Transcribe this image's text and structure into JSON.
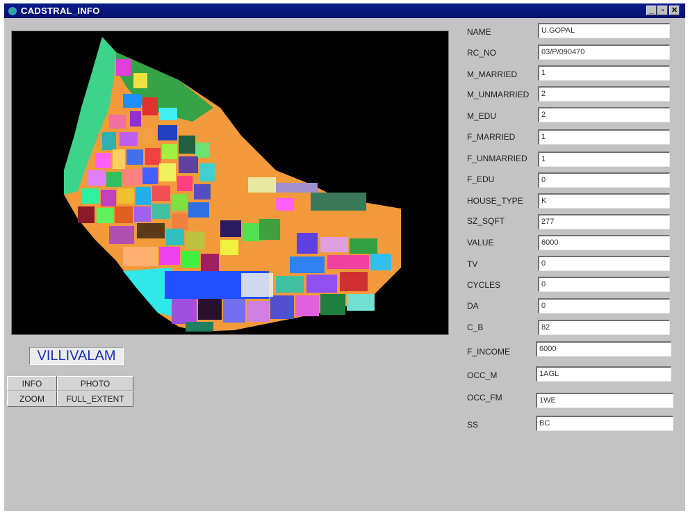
{
  "window": {
    "title": "CADSTRAL_INFO",
    "controls": {
      "minimize": "_",
      "restore": "▫",
      "close": "✕"
    }
  },
  "village_label": "VILLIVALAM",
  "toolbar": {
    "info": "INFO",
    "photo": "PHOTO",
    "zoom": "ZOOM",
    "full_extent": "FULL_EXTENT"
  },
  "fields": [
    {
      "label": "NAME",
      "value": "U.GOPAL"
    },
    {
      "label": "RC_NO",
      "value": "03/P/090470"
    },
    {
      "label": "M_MARRIED",
      "value": "1"
    },
    {
      "label": "M_UNMARRIED",
      "value": "2"
    },
    {
      "label": "M_EDU",
      "value": "2"
    },
    {
      "label": "F_MARRIED",
      "value": "1"
    },
    {
      "label": "F_UNMARRIED",
      "value": "1"
    },
    {
      "label": "F_EDU",
      "value": "0"
    },
    {
      "label": "HOUSE_TYPE",
      "value": "K"
    },
    {
      "label": "SZ_SQFT",
      "value": "277"
    },
    {
      "label": "VALUE",
      "value": "6000"
    },
    {
      "label": "TV",
      "value": "0"
    },
    {
      "label": "CYCLES",
      "value": "0"
    },
    {
      "label": "DA",
      "value": "0"
    },
    {
      "label": "C_B",
      "value": "82"
    },
    {
      "label": "F_INCOME",
      "value": "6000"
    },
    {
      "label": "OCC_M",
      "value": "1AGL"
    },
    {
      "label": "OCC_FM",
      "value": "1WE"
    },
    {
      "label": "SS",
      "value": "BC"
    }
  ]
}
